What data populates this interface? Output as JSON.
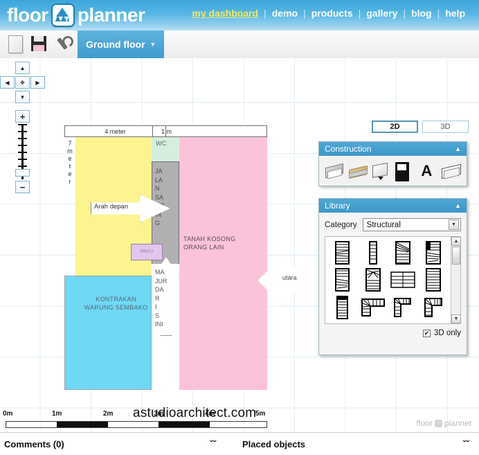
{
  "header": {
    "logo_text_left": "floor",
    "logo_text_right": "planner",
    "logo_icon": "floorplanner-logo-icon",
    "nav": [
      {
        "label": "my dashboard",
        "active": true
      },
      {
        "label": "demo",
        "active": false
      },
      {
        "label": "products",
        "active": false
      },
      {
        "label": "gallery",
        "active": false
      },
      {
        "label": "blog",
        "active": false
      },
      {
        "label": "help",
        "active": false
      }
    ],
    "separator": "|"
  },
  "toolbar": {
    "icons": [
      {
        "name": "new-document-icon",
        "title": "New"
      },
      {
        "name": "save-icon",
        "title": "Save"
      },
      {
        "name": "settings-wrench-icon",
        "title": "Settings"
      }
    ],
    "floor_tab_label": "Ground floor",
    "floor_tab_caret": "▼"
  },
  "view_toggle": {
    "options": [
      {
        "label": "2D",
        "active": true
      },
      {
        "label": "3D",
        "active": false
      }
    ]
  },
  "nav_pad": {
    "up": "▲",
    "left": "◀",
    "center": "✥",
    "right": "▶",
    "down": "▼",
    "zoom_in": "+",
    "zoom_out": "−"
  },
  "construction_panel": {
    "title": "Construction",
    "collapse_icon": "▲",
    "tools": [
      {
        "name": "wall-tool-icon",
        "label": "Wall"
      },
      {
        "name": "floor-surface-tool-icon",
        "label": "Floor"
      },
      {
        "name": "window-tool-icon",
        "label": "Window"
      },
      {
        "name": "door-tool-icon",
        "label": "Door"
      },
      {
        "name": "text-tool-icon",
        "label": "A"
      },
      {
        "name": "area-tool-icon",
        "label": "Area"
      }
    ]
  },
  "library_panel": {
    "title": "Library",
    "collapse_icon": "▲",
    "category_label": "Category",
    "category_value": "Structural",
    "category_caret": "▼",
    "items_count": 12,
    "item_name": "staircase-thumbnail",
    "scroll_up": "▲",
    "scroll_down": "▼",
    "only_3d_label": "3D only",
    "only_3d_checked": true,
    "checkmark": "✔"
  },
  "plan": {
    "dimension_top_left": "4 meter",
    "dimension_top_right": "1 m",
    "dimension_left": "7 meter",
    "labels": {
      "pink_area_line1": "TANAH KOSONG",
      "pink_area_line2": "ORANG LAIN",
      "blue_area_line1": "KONTRAKAN",
      "blue_area_line2": "WARUNG SEMBAKO",
      "wc": "WC",
      "corridor_vertical": "JALAN SAMPING",
      "entry_vertical": "MASUK DARI SINI",
      "arrow_front": "Arah depan",
      "arrow_north": "utara",
      "purple_box": "PINTU"
    },
    "watermark": "astudioarchitect.com",
    "colors": {
      "yellow": "#fbf48f",
      "blue": "#6fd8f5",
      "pink": "#fac3da",
      "gray": "#b0b0b0",
      "green": "#d6eede",
      "purple": "#e2c6ec"
    }
  },
  "ruler": {
    "ticks": [
      "0m",
      "1m",
      "2m",
      "3m",
      "4m",
      "5m"
    ],
    "brand_left": "floor",
    "brand_right": "planner"
  },
  "footer": {
    "comments_label": "Comments (0)",
    "placed_objects_label": "Placed objects",
    "expand_icon": "ˇˇ"
  }
}
